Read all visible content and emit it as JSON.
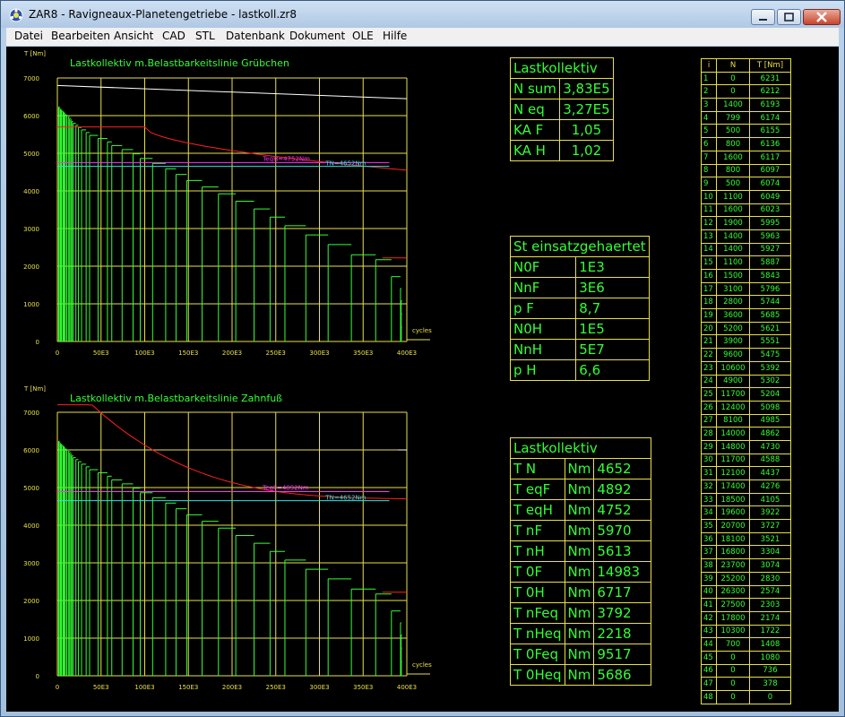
{
  "window": {
    "title": "ZAR8 - Ravigneaux-Planetengetriebe  -  lastkoll.zr8"
  },
  "menu": [
    "Datei",
    "Bearbeiten",
    "Ansicht",
    "CAD",
    "STL",
    "Datenbank",
    "Dokument",
    "OLE",
    "Hilfe"
  ],
  "colors": {
    "background": "#000000",
    "grid": "#e8e04a",
    "bars": "#33ff33",
    "limit_line": "#ff2020",
    "teq_line": "#ff33ff",
    "tn_line": "#33e0e0",
    "top_line": "#ffffff"
  },
  "chart_data": [
    {
      "type": "bar",
      "title": "Lastkollektiv m.Belastbarkeitslinie Grübchen",
      "ylabel": "T [Nm]",
      "xlabel": "cycles",
      "yticks": [
        "0",
        "1000",
        "2000",
        "3000",
        "4000",
        "5000",
        "6000",
        "7000"
      ],
      "xticks": [
        "0",
        "50E3",
        "100E3",
        "150E3",
        "200E3",
        "250E3",
        "300E3",
        "350E3",
        "400E3"
      ],
      "ylim": [
        0,
        7000
      ],
      "xlim": [
        0,
        400000
      ],
      "annotations": [
        "TeqH=4752Nm",
        "TN=4652Nm"
      ],
      "lines": {
        "TeqH": 4752,
        "TN": 4652
      }
    },
    {
      "type": "bar",
      "title": "Lastkollektiv m.Belastbarkeitslinie Zahnfuß",
      "ylabel": "T [Nm]",
      "xlabel": "cycles",
      "yticks": [
        "0",
        "1000",
        "2000",
        "3000",
        "4000",
        "5000",
        "6000",
        "7000"
      ],
      "xticks": [
        "0",
        "50E3",
        "100E3",
        "150E3",
        "200E3",
        "250E3",
        "300E3",
        "350E3",
        "400E3"
      ],
      "ylim": [
        0,
        7000
      ],
      "xlim": [
        0,
        400000
      ],
      "annotations": [
        "TeqF=4892Nm",
        "TN=4652Nm"
      ],
      "lines": {
        "TeqF": 4892,
        "TN": 4652
      }
    }
  ],
  "table_lastkollektiv_1": {
    "header": "Lastkollektiv",
    "rows": [
      [
        "N sum",
        "3,83E5"
      ],
      [
        "N eq",
        "3,27E5"
      ],
      [
        "KA F",
        "1,05"
      ],
      [
        "KA H",
        "1,02"
      ]
    ]
  },
  "table_material": {
    "header": "St einsatzgehaertet",
    "rows": [
      [
        "N0F",
        "1E3"
      ],
      [
        "NnF",
        "3E6"
      ],
      [
        "p F",
        "8,7"
      ],
      [
        "N0H",
        "1E5"
      ],
      [
        "NnH",
        "5E7"
      ],
      [
        "p H",
        "6,6"
      ]
    ]
  },
  "table_lastkollektiv_2": {
    "header": "Lastkollektiv",
    "rows": [
      [
        "T N",
        "Nm",
        "4652"
      ],
      [
        "T eqF",
        "Nm",
        "4892"
      ],
      [
        "T eqH",
        "Nm",
        "4752"
      ],
      [
        "T nF",
        "Nm",
        "5970"
      ],
      [
        "T nH",
        "Nm",
        "5613"
      ],
      [
        "T 0F",
        "Nm",
        "14983"
      ],
      [
        "T 0H",
        "Nm",
        "6717"
      ],
      [
        "T nFeq",
        "Nm",
        "3792"
      ],
      [
        "T nHeq",
        "Nm",
        "2218"
      ],
      [
        "T 0Feq",
        "Nm",
        "9517"
      ],
      [
        "T 0Heq",
        "Nm",
        "5686"
      ]
    ]
  },
  "load_table": {
    "columns": [
      "i",
      "N",
      "T [Nm]"
    ],
    "rows": [
      [
        "1",
        "0",
        "6231"
      ],
      [
        "2",
        "0",
        "6212"
      ],
      [
        "3",
        "1400",
        "6193"
      ],
      [
        "4",
        "799",
        "6174"
      ],
      [
        "5",
        "500",
        "6155"
      ],
      [
        "6",
        "800",
        "6136"
      ],
      [
        "7",
        "1600",
        "6117"
      ],
      [
        "8",
        "800",
        "6097"
      ],
      [
        "9",
        "500",
        "6074"
      ],
      [
        "10",
        "1100",
        "6049"
      ],
      [
        "11",
        "1600",
        "6023"
      ],
      [
        "12",
        "1900",
        "5995"
      ],
      [
        "13",
        "1400",
        "5963"
      ],
      [
        "14",
        "1400",
        "5927"
      ],
      [
        "15",
        "1100",
        "5887"
      ],
      [
        "16",
        "1500",
        "5843"
      ],
      [
        "17",
        "3100",
        "5796"
      ],
      [
        "18",
        "2800",
        "5744"
      ],
      [
        "19",
        "3600",
        "5685"
      ],
      [
        "20",
        "5200",
        "5621"
      ],
      [
        "21",
        "3900",
        "5551"
      ],
      [
        "22",
        "9600",
        "5475"
      ],
      [
        "23",
        "10600",
        "5392"
      ],
      [
        "24",
        "4900",
        "5302"
      ],
      [
        "25",
        "11700",
        "5204"
      ],
      [
        "26",
        "12400",
        "5098"
      ],
      [
        "27",
        "8100",
        "4985"
      ],
      [
        "28",
        "14000",
        "4862"
      ],
      [
        "29",
        "14800",
        "4730"
      ],
      [
        "30",
        "11700",
        "4588"
      ],
      [
        "31",
        "12100",
        "4437"
      ],
      [
        "32",
        "17400",
        "4276"
      ],
      [
        "33",
        "18500",
        "4105"
      ],
      [
        "34",
        "19600",
        "3922"
      ],
      [
        "35",
        "20700",
        "3727"
      ],
      [
        "36",
        "18100",
        "3521"
      ],
      [
        "37",
        "16800",
        "3304"
      ],
      [
        "38",
        "23700",
        "3074"
      ],
      [
        "39",
        "25200",
        "2830"
      ],
      [
        "40",
        "26300",
        "2574"
      ],
      [
        "41",
        "27500",
        "2303"
      ],
      [
        "42",
        "17800",
        "2174"
      ],
      [
        "43",
        "10300",
        "1722"
      ],
      [
        "44",
        "700",
        "1408"
      ],
      [
        "45",
        "0",
        "1080"
      ],
      [
        "46",
        "0",
        "736"
      ],
      [
        "47",
        "0",
        "378"
      ],
      [
        "48",
        "0",
        "0"
      ]
    ]
  }
}
